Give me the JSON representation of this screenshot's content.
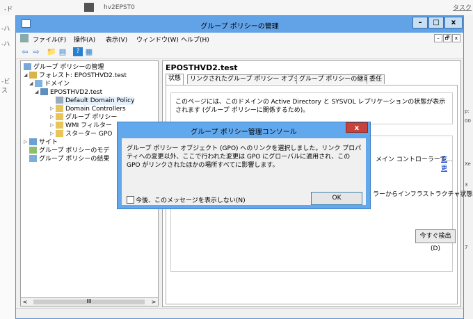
{
  "background": {
    "left_label": "-ド",
    "server_name": "hv2EPST0",
    "task_label": "タスク",
    "left_col": [
      "-ハ",
      "-ハ",
      "-ビス"
    ],
    "right_col": [
      "p:",
      "00",
      "Xe",
      "3",
      "7"
    ]
  },
  "window": {
    "title": "グループ ポリシーの管理",
    "min": "–",
    "max": "□",
    "close": "x"
  },
  "menu": {
    "items": [
      "ファイル(F)",
      "操作(A)",
      "表示(V)",
      "ウィンドウ(W)",
      "ヘルプ(H)"
    ],
    "mdi": [
      "–",
      "🗗",
      "x"
    ]
  },
  "toolbar": {
    "icons": [
      "back-arrow-icon",
      "forward-arrow-icon",
      "up-folder-icon",
      "show-hide-tree-icon",
      "help-icon",
      "properties-icon"
    ],
    "glyphs": [
      "⇦",
      "⇨",
      "📁",
      "▤",
      "?",
      "▦"
    ]
  },
  "tree": {
    "nodes": [
      {
        "label": "グループ ポリシーの管理",
        "icon": "gpm-icon",
        "expander": ""
      },
      {
        "label": "フォレスト: EPOSTHVD2.test",
        "icon": "forest-icon",
        "expander": "◢"
      },
      {
        "label": "ドメイン",
        "icon": "domains-icon",
        "expander": "◢"
      },
      {
        "label": "EPOSTHVD2.test",
        "icon": "domain-icon",
        "expander": "◢"
      },
      {
        "label": "Default Domain Policy",
        "icon": "gpo-link-icon",
        "expander": ""
      },
      {
        "label": "Domain Controllers",
        "icon": "ou-icon",
        "expander": "▷"
      },
      {
        "label": "グループ ポリシー",
        "icon": "gpo-folder-icon",
        "expander": "▷"
      },
      {
        "label": "WMI フィルター",
        "icon": "wmi-folder-icon",
        "expander": "▷"
      },
      {
        "label": "スターター GPO",
        "icon": "starter-gpo-icon",
        "expander": "▷"
      },
      {
        "label": "サイト",
        "icon": "sites-icon",
        "expander": "▷"
      },
      {
        "label": "グループ ポリシーのモデ",
        "icon": "modeling-icon",
        "expander": ""
      },
      {
        "label": "グループ ポリシーの結果",
        "icon": "results-icon",
        "expander": ""
      }
    ],
    "scroll_left": "<",
    "scroll_mid": "III",
    "scroll_right": ">"
  },
  "content": {
    "domain_title": "EPOSTHVD2.test",
    "tabs": [
      "状態",
      "リンクされたグループ ポリシー オブジェクト",
      "グループ ポリシーの継承",
      "委任"
    ],
    "intro": "このページには、このドメインの Active Directory と SYSVOL レプリケーションの状態が表示されます (グループ ポリシーに関係するため)。",
    "dc_text": "メイン コントローラーで...",
    "dc_link": "変更",
    "infra_text": "ラーからインフラストラクチャ状態",
    "detect_button": "今すぐ検出(D)"
  },
  "dialog": {
    "title": "グループ ポリシー管理コンソール",
    "close": "x",
    "message": "グループ ポリシー オブジェクト (GPO) へのリンクを選択しました。リンク プロパティへの変更以外、ここで行われた変更は GPO にグローバルに適用され、この GPO がリンクされたほかの場所すべてに影響します。",
    "checkbox_label": "今後、このメッセージを表示しない(N)",
    "ok": "OK"
  },
  "colors": {
    "title_bar": "#62a3e8",
    "dialog_frame": "#61a8ec",
    "close_red": "#c9423a",
    "link": "#0033cc"
  }
}
